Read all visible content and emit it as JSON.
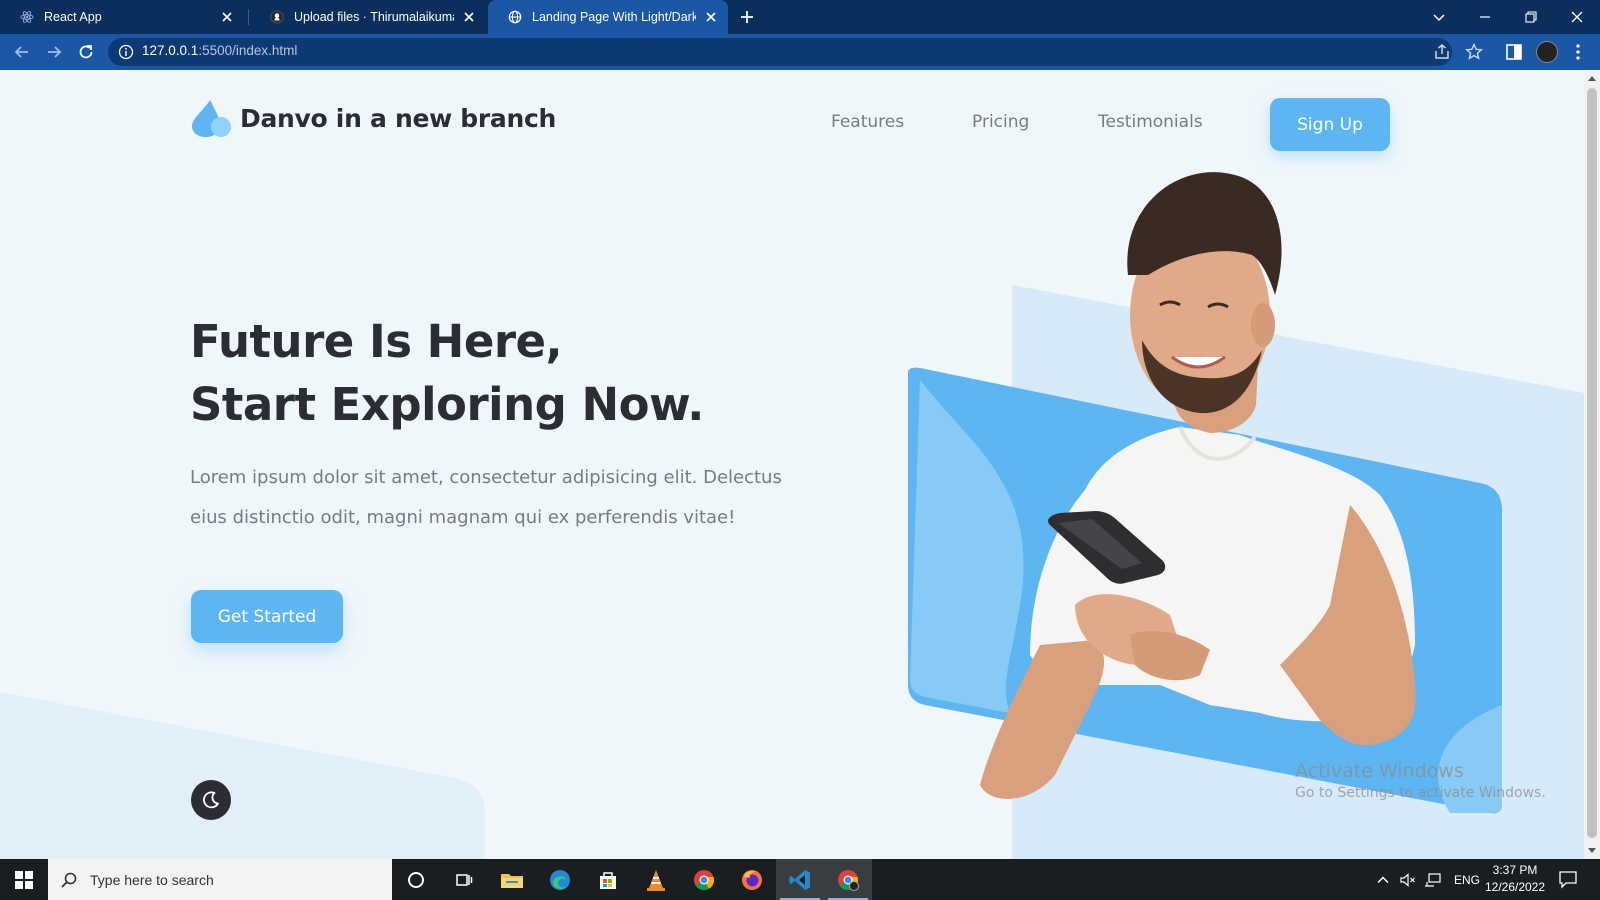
{
  "browser": {
    "tabs": [
      {
        "label": "React App",
        "icon": "react-icon"
      },
      {
        "label": "Upload files · Thirumalaikumar-M",
        "icon": "github-icon"
      },
      {
        "label": "Landing Page With Light/Dark M",
        "icon": "globe-icon",
        "active": true
      }
    ],
    "url_host": "127.0.0.1",
    "url_path": ":5500/index.html"
  },
  "page": {
    "brand": "Danvo in a new branch",
    "nav": {
      "features": "Features",
      "pricing": "Pricing",
      "testimonials": "Testimonials",
      "signup": "Sign Up"
    },
    "headline_line1": "Future Is Here,",
    "headline_line2": "Start Exploring Now.",
    "lead": "Lorem ipsum dolor sit amet, consectetur adipisicing elit. Delectus eius distinctio odit, magni magnam qui ex perferendis vitae!",
    "cta": "Get Started",
    "accent_color": "#5db6f2",
    "dark_text_color": "#2c2c35"
  },
  "watermark": {
    "title": "Activate Windows",
    "subtitle": "Go to Settings to activate Windows."
  },
  "taskbar": {
    "search_placeholder": "Type here to search",
    "language": "ENG",
    "time": "3:37 PM",
    "date": "12/26/2022"
  }
}
